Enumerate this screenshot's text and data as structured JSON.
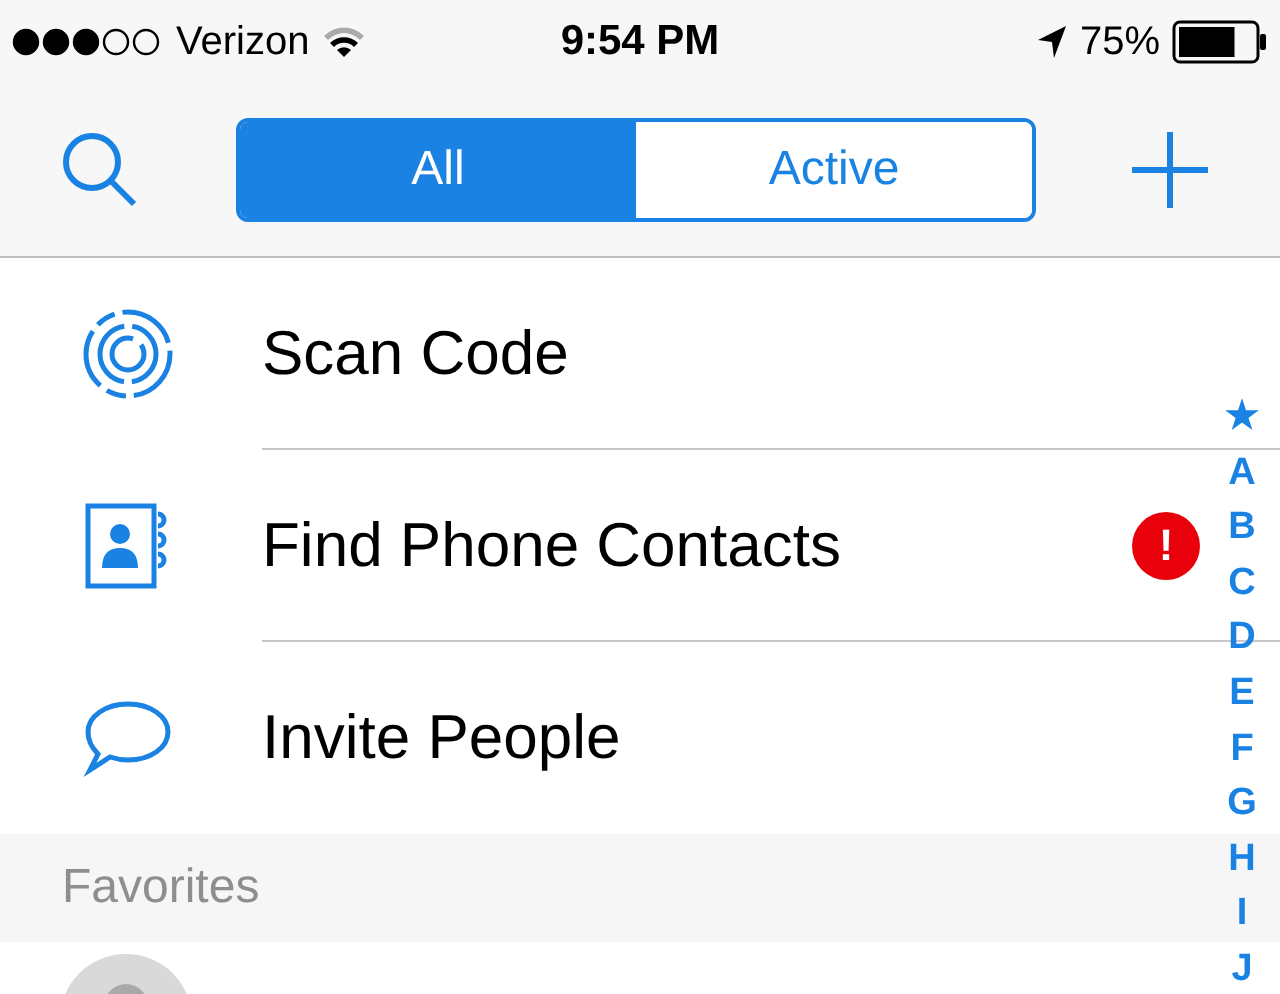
{
  "status_bar": {
    "carrier": "Verizon",
    "time": "9:54 PM",
    "battery": "75%"
  },
  "nav": {
    "segments": [
      {
        "label": "All",
        "selected": true
      },
      {
        "label": "Active",
        "selected": false
      }
    ]
  },
  "rows": [
    {
      "kind": "scan",
      "label": "Scan Code"
    },
    {
      "kind": "contacts",
      "label": "Find Phone Contacts",
      "badge": "!"
    },
    {
      "kind": "chat",
      "label": "Invite People"
    }
  ],
  "section_header": "Favorites",
  "index": [
    "★",
    "A",
    "B",
    "C",
    "D",
    "E",
    "F",
    "G",
    "H",
    "I",
    "J"
  ]
}
